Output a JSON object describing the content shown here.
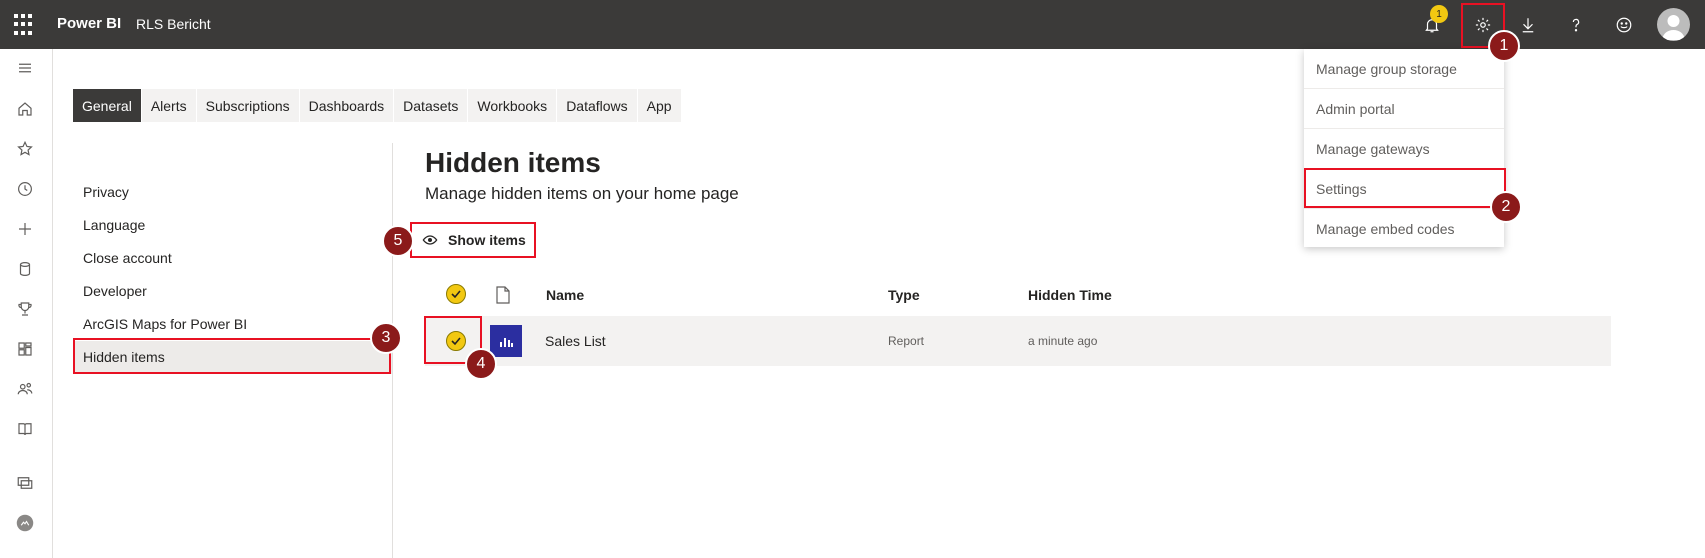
{
  "topbar": {
    "brand": "Power BI",
    "report_name": "RLS Bericht",
    "notification_count": "1",
    "icons": [
      "waffle-icon",
      "bell-icon",
      "gear-icon",
      "download-icon",
      "help-icon",
      "smiley-icon",
      "avatar-icon"
    ]
  },
  "tabs": [
    {
      "label": "General",
      "active": true
    },
    {
      "label": "Alerts"
    },
    {
      "label": "Subscriptions"
    },
    {
      "label": "Dashboards"
    },
    {
      "label": "Datasets"
    },
    {
      "label": "Workbooks"
    },
    {
      "label": "Dataflows"
    },
    {
      "label": "App"
    }
  ],
  "settings_nav": [
    {
      "label": "Privacy"
    },
    {
      "label": "Language"
    },
    {
      "label": "Close account"
    },
    {
      "label": "Developer"
    },
    {
      "label": "ArcGIS Maps for Power BI"
    },
    {
      "label": "Hidden items",
      "active": true
    }
  ],
  "main": {
    "title": "Hidden items",
    "subtitle": "Manage hidden items on your home page",
    "show_items_label": "Show items",
    "columns": {
      "name": "Name",
      "type": "Type",
      "hidden_time": "Hidden Time"
    },
    "rows": [
      {
        "name": "Sales List",
        "type": "Report",
        "hidden_time": "a minute ago",
        "checked": true
      }
    ]
  },
  "gear_menu": {
    "items": [
      {
        "label": "Manage group storage"
      },
      {
        "label": "Admin portal"
      },
      {
        "label": "Manage gateways"
      },
      {
        "label": "Settings"
      },
      {
        "label": "Manage embed codes"
      }
    ]
  },
  "annotations": {
    "step1": "1",
    "step2": "2",
    "step3": "3",
    "step4": "4",
    "step5": "5"
  },
  "colors": {
    "topbar": "#3b3a39",
    "accent_yellow": "#f2c811",
    "highlight_red": "#e81123",
    "step_marker": "#8b1a1a",
    "report_icon": "#2b2ea0"
  }
}
